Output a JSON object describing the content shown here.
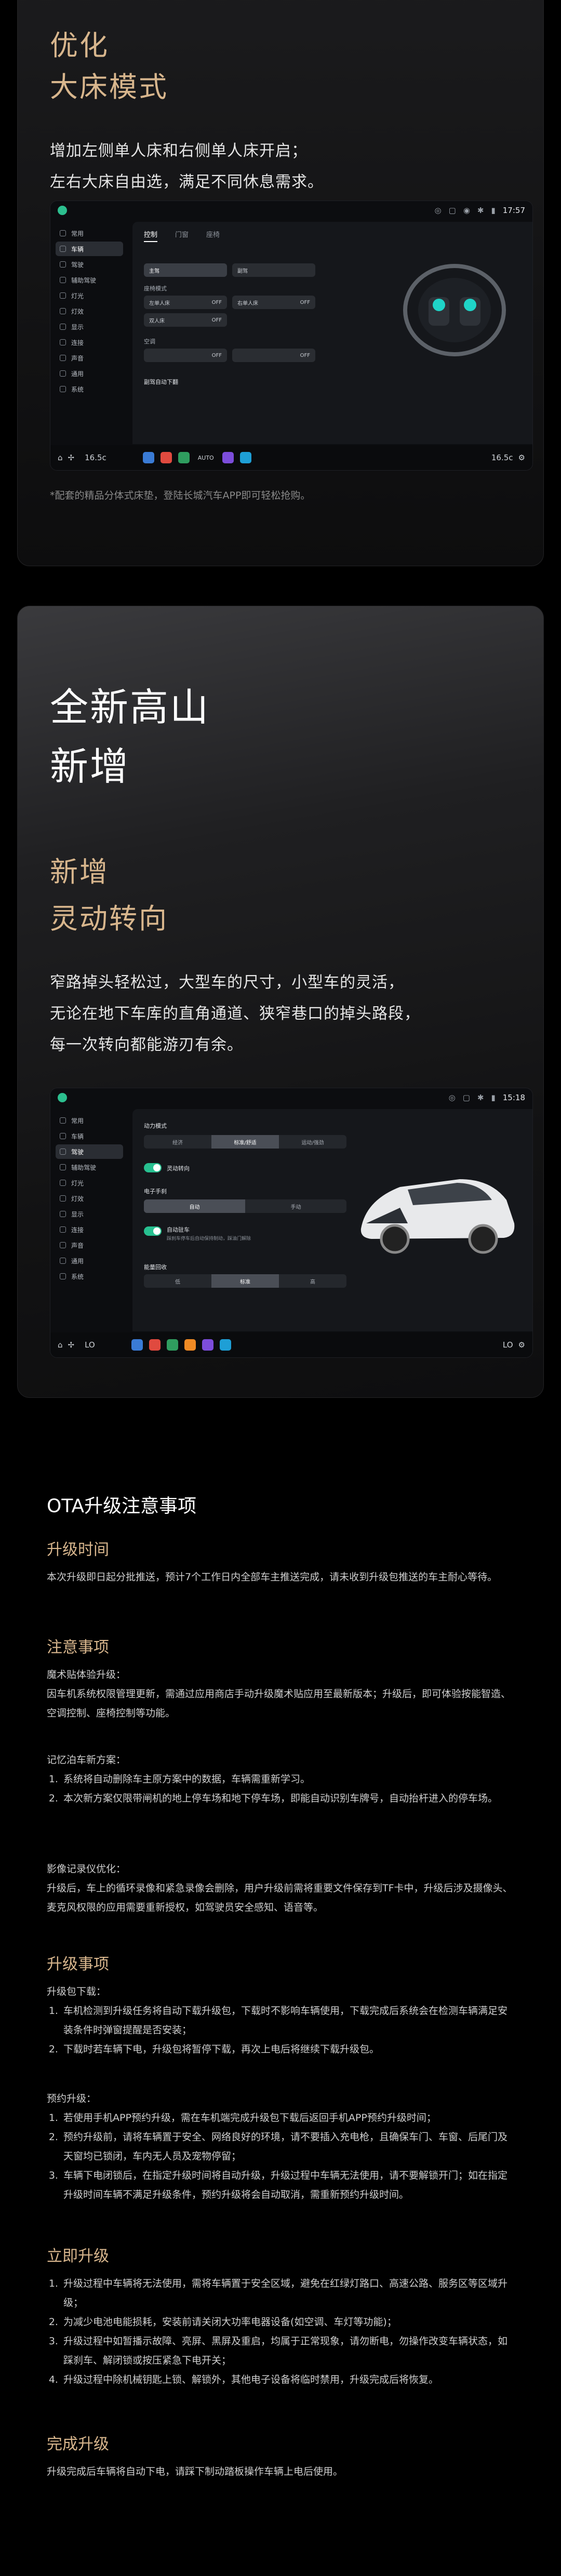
{
  "section1": {
    "title_line1": "优化",
    "title_line2": "大床模式",
    "desc_line1": "增加左侧单人床和右侧单人床开启；",
    "desc_line2": "左右大床自由选，满足不同休息需求。",
    "footnote": "*配套的精品分体式床垫，登陆长城汽车APP即可轻松抢购。",
    "screen": {
      "time": "17:57",
      "sidebar": [
        "常用",
        "车辆",
        "驾驶",
        "辅助驾驶",
        "灯光",
        "灯效",
        "显示",
        "连接",
        "声音",
        "通用",
        "系统"
      ],
      "active_index": 1,
      "tabs": [
        "控制",
        "门窗",
        "座椅"
      ],
      "active_tab": "控制",
      "row1": [
        "主驾",
        "副驾"
      ],
      "section_label": "座椅模式",
      "row2": [
        "左单人床",
        "OFF",
        "右单人床",
        "OFF"
      ],
      "row3": [
        "双人床",
        "OFF"
      ],
      "section2_label": "空调",
      "row4": [
        "OFF",
        "OFF"
      ],
      "footer_label": "副驾自动下翻",
      "dock_temp_left": "16.5c",
      "dock_temp_right": "16.5c",
      "dock_auto": "AUTO"
    }
  },
  "section2": {
    "title_line1": "全新高山",
    "title_line2": "新增",
    "sub_line1": "新增",
    "sub_line2": "灵动转向",
    "desc_line1": "窄路掉头轻松过，大型车的尺寸，小型车的灵活，",
    "desc_line2": "无论在地下车库的直角通道、狭窄巷口的掉头路段，",
    "desc_line3": "每一次转向都能游刃有余。",
    "screen": {
      "time": "15:18",
      "sidebar": [
        "常用",
        "车辆",
        "驾驶",
        "辅助驾驶",
        "灯光",
        "灯效",
        "显示",
        "连接",
        "声音",
        "通用",
        "系统"
      ],
      "active_index": 2,
      "drive_mode_label": "动力模式",
      "drive_modes": [
        "经济",
        "标准/舒适",
        "运动/强劲"
      ],
      "steering_label": "灵动转向",
      "assist_label": "电子手刹",
      "assist_options": [
        "自动",
        "手动"
      ],
      "hold_label": "自动驻车",
      "hold_desc": "踩刹车停车后自动保持制动，踩油门解除",
      "regen_label": "能量回收",
      "regen_options": [
        "低",
        "标准",
        "高"
      ],
      "dock_left": "LO",
      "dock_right": "LO"
    }
  },
  "ota": {
    "title": "OTA升级注意事项",
    "s1_title": "升级时间",
    "s1_text": "本次升级即日起分批推送，预计7个工作日内全部车主推送完成，请未收到升级包推送的车主耐心等待。",
    "s2_title": "注意事项",
    "s2_a_head": "魔术贴体验升级：",
    "s2_a_text": "因车机系统权限管理更新，需通过应用商店手动升级魔术贴应用至最新版本；升级后，即可体验按能智造、空调控制、座椅控制等功能。",
    "s2_b_head": "记忆泊车新方案：",
    "s2_b_items": [
      "系统将自动删除车主原方案中的数据，车辆需重新学习。",
      "本次新方案仅限带闸机的地上停车场和地下停车场，即能自动识别车牌号，自动抬杆进入的停车场。"
    ],
    "s2_c_head": "影像记录仪优化：",
    "s2_c_text": "升级后，车上的循环录像和紧急录像会删除，用户升级前需将重要文件保存到TF卡中，升级后涉及摄像头、麦克风权限的应用需要重新授权，如驾驶员安全感知、语音等。",
    "s3_title": "升级事项",
    "s3_a_head": "升级包下载：",
    "s3_a_items": [
      "车机检测到升级任务将自动下载升级包，下载时不影响车辆使用，下载完成后系统会在检测车辆满足安装条件时弹窗提醒是否安装；",
      "下载时若车辆下电，升级包将暂停下载，再次上电后将继续下载升级包。"
    ],
    "s3_b_head": "预约升级：",
    "s3_b_items": [
      "若使用手机APP预约升级，需在车机端完成升级包下载后返回手机APP预约升级时间；",
      "预约升级前，请将车辆置于安全、网络良好的环境，请不要插入充电枪，且确保车门、车窗、后尾门及天窗均已锁闭，车内无人员及宠物停留；",
      "车辆下电闭锁后，在指定升级时间将自动升级，升级过程中车辆无法使用，请不要解锁开门；如在指定升级时间车辆不满足升级条件，预约升级将会自动取消，需重新预约升级时间。"
    ],
    "s4_title": "立即升级",
    "s4_items": [
      "升级过程中车辆将无法使用，需将车辆置于安全区域，避免在红绿灯路口、高速公路、服务区等区域升级；",
      "为减少电池电能损耗，安装前请关闭大功率电器设备(如空调、车灯等功能)；",
      "升级过程中如暂播示故障、亮屏、黑屏及重启，均属于正常现象，请勿断电，勿操作改变车辆状态，如踩刹车、解闭锁或按压紧急下电开关；",
      "升级过程中除机械钥匙上锁、解锁外，其他电子设备将临时禁用，升级完成后将恢复。"
    ],
    "s5_title": "完成升级",
    "s5_text": "升级完成后车辆将自动下电，请踩下制动踏板操作车辆上电后使用。"
  },
  "colors": {
    "gold": "#d8b68d",
    "accent_green": "#27c090",
    "background": "#000000"
  }
}
